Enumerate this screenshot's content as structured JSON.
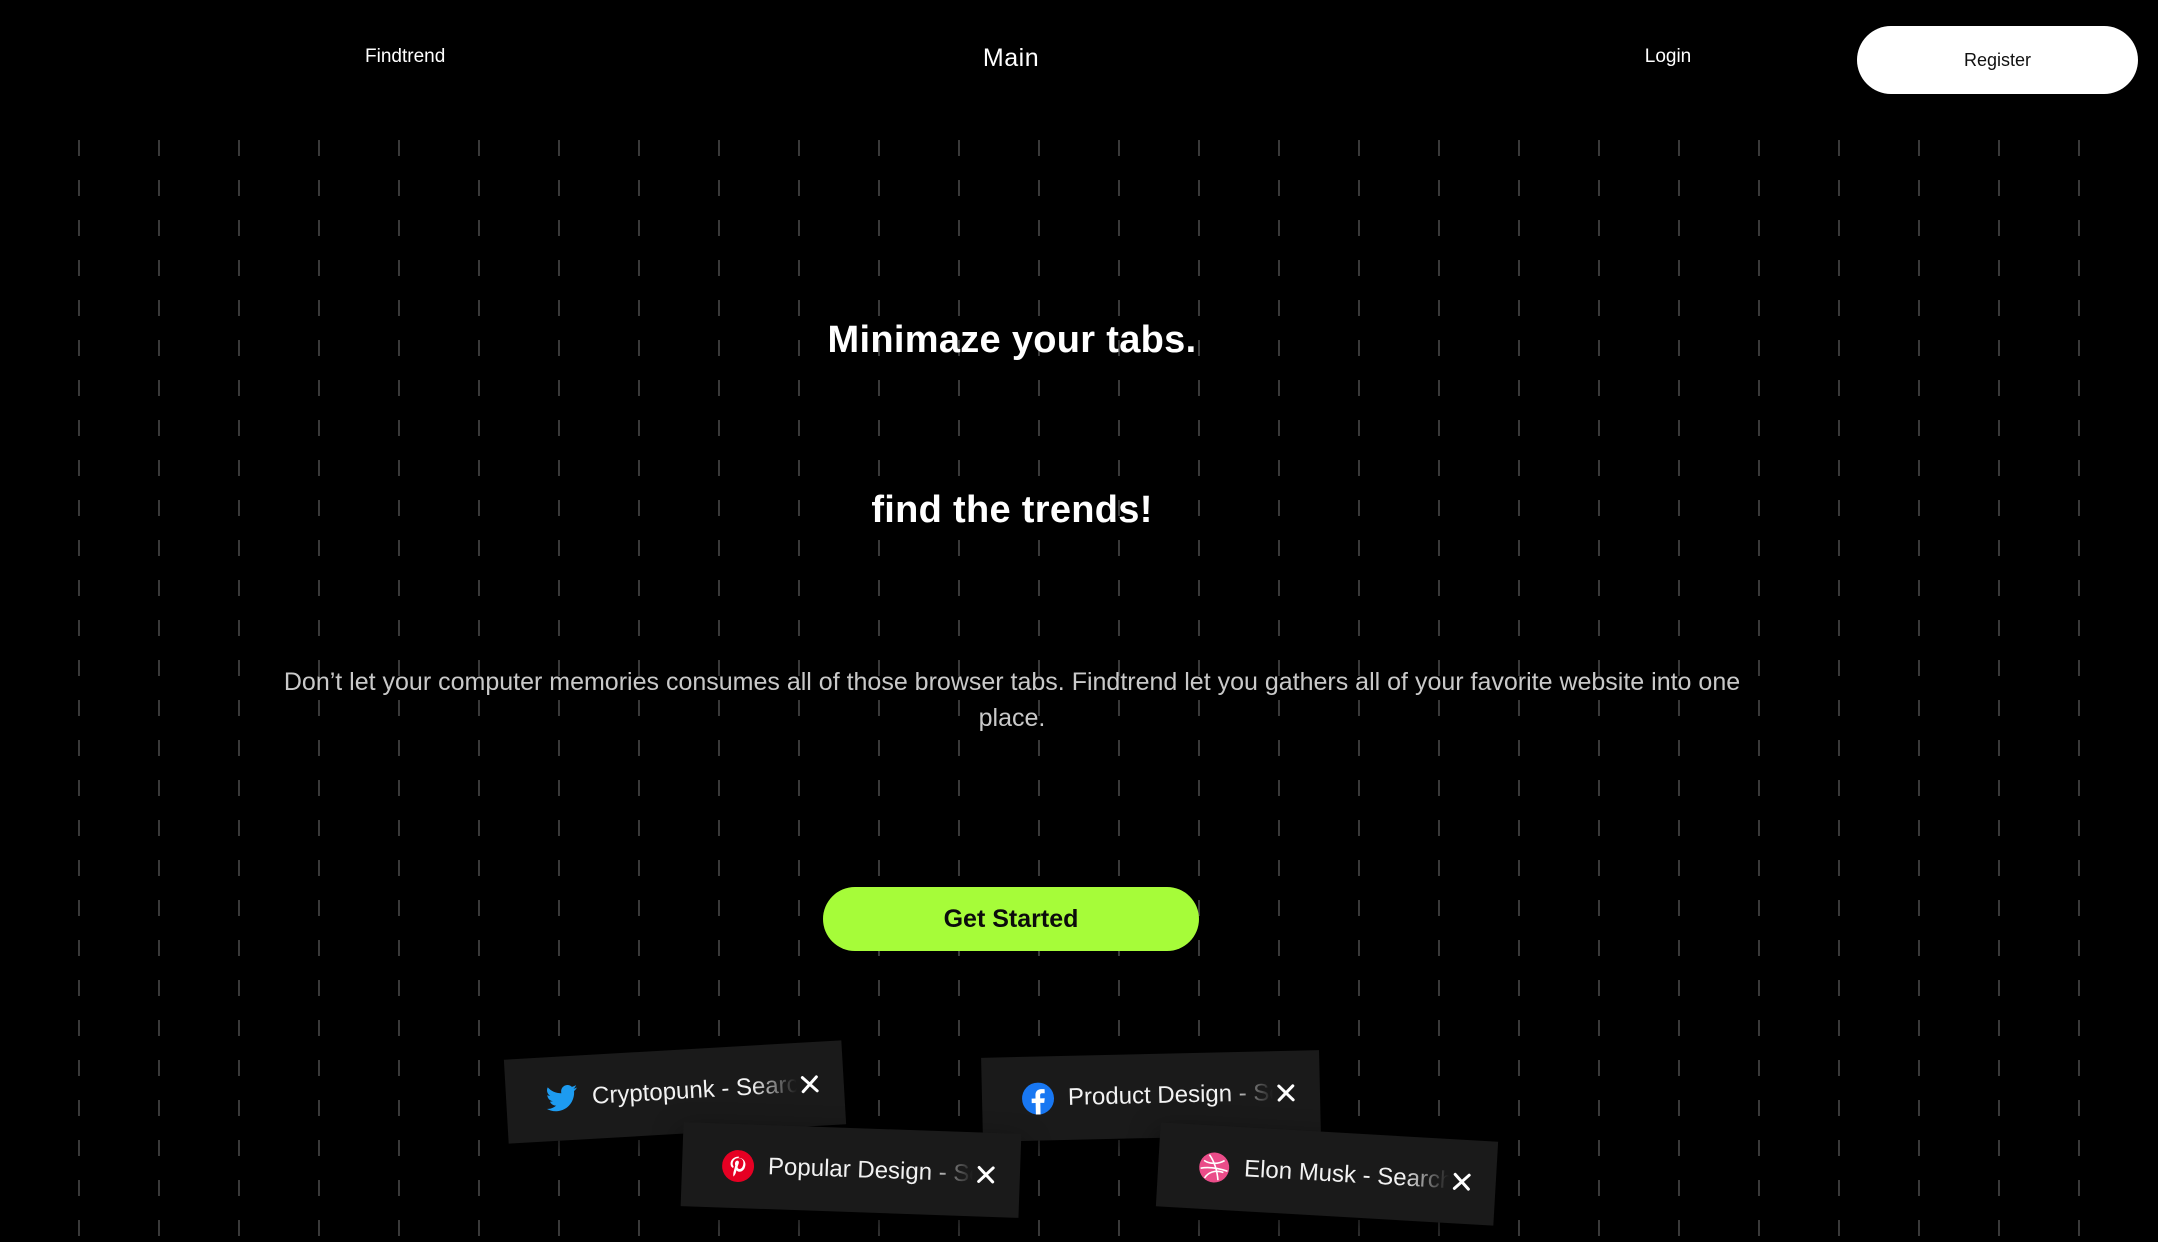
{
  "nav": {
    "logo": "Findtrend",
    "main_link": "Main",
    "login_link": "Login",
    "register_button": "Register"
  },
  "hero": {
    "title_line_1": "Minimaze your tabs.",
    "title_line_2": "find the trends!",
    "description": "Don’t let your computer memories consumes all of those browser tabs. Findtrend let you gathers all of your favorite website into one place.",
    "cta_label": "Get Started"
  },
  "tabs": [
    {
      "title": "Cryptopunk - Search",
      "icon": "twitter-icon",
      "icon_color": "#1d9bf0"
    },
    {
      "title": "Product Design - Search",
      "icon": "facebook-icon",
      "icon_color": "#1877f2"
    },
    {
      "title": "Popular Design - Search",
      "icon": "pinterest-icon",
      "icon_color": "#e60023"
    },
    {
      "title": "Elon Musk - Search",
      "icon": "dribbble-icon",
      "icon_color": "#ea4c89"
    }
  ],
  "colors": {
    "background": "#000000",
    "accent": "#a6fc39",
    "register_bg": "#ffffff",
    "tab_card_bg": "#1a1a1a",
    "description_text": "#c9c9c9"
  }
}
